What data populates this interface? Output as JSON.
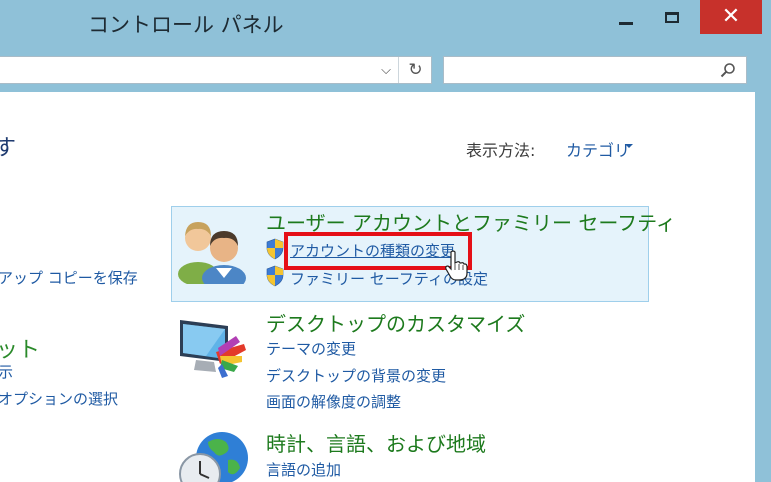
{
  "window": {
    "title": "コントロール パネル",
    "close_glyph": "✕"
  },
  "address": {
    "dropdown_icon": "chevron-down-icon",
    "dropdown_glyph": "⌵",
    "refresh_icon": "refresh-icon",
    "refresh_glyph": "↻"
  },
  "search": {
    "placeholder": "",
    "icon": "search-icon"
  },
  "page": {
    "heading_fragment": "す",
    "view_by_label": "表示方法:",
    "view_by_value": "カテゴリ"
  },
  "left_column": {
    "backup_link_fragment": "アップ コピーを保存",
    "category_fragment": "ット",
    "link_fragment_1": "示",
    "link_fragment_2": "オプションの選択"
  },
  "categories": [
    {
      "title": "ユーザー アカウントとファミリー セーフティ",
      "icon": "users-icon",
      "highlighted": true,
      "links": [
        {
          "label": "アカウントの種類の変更",
          "shield": true,
          "hovered": true
        },
        {
          "label": "ファミリー セーフティの設定",
          "shield": true,
          "hovered": false
        }
      ]
    },
    {
      "title": "デスクトップのカスタマイズ",
      "icon": "monitor-palette-icon",
      "highlighted": false,
      "links": [
        {
          "label": "テーマの変更"
        },
        {
          "label": "デスクトップの背景の変更"
        },
        {
          "label": "画面の解像度の調整"
        }
      ]
    },
    {
      "title": "時計、言語、および地域",
      "icon": "globe-clock-icon",
      "highlighted": false,
      "links": [
        {
          "label": "言語の追加"
        }
      ]
    }
  ],
  "colors": {
    "titlebar": "#8fc1d8",
    "close_button": "#c7312b",
    "link": "#1f5aa3",
    "category": "#1d7a1d",
    "highlight_bg": "#e5f3fb",
    "highlight_border": "#9fcfeb",
    "annotation_red": "#e50f17"
  }
}
